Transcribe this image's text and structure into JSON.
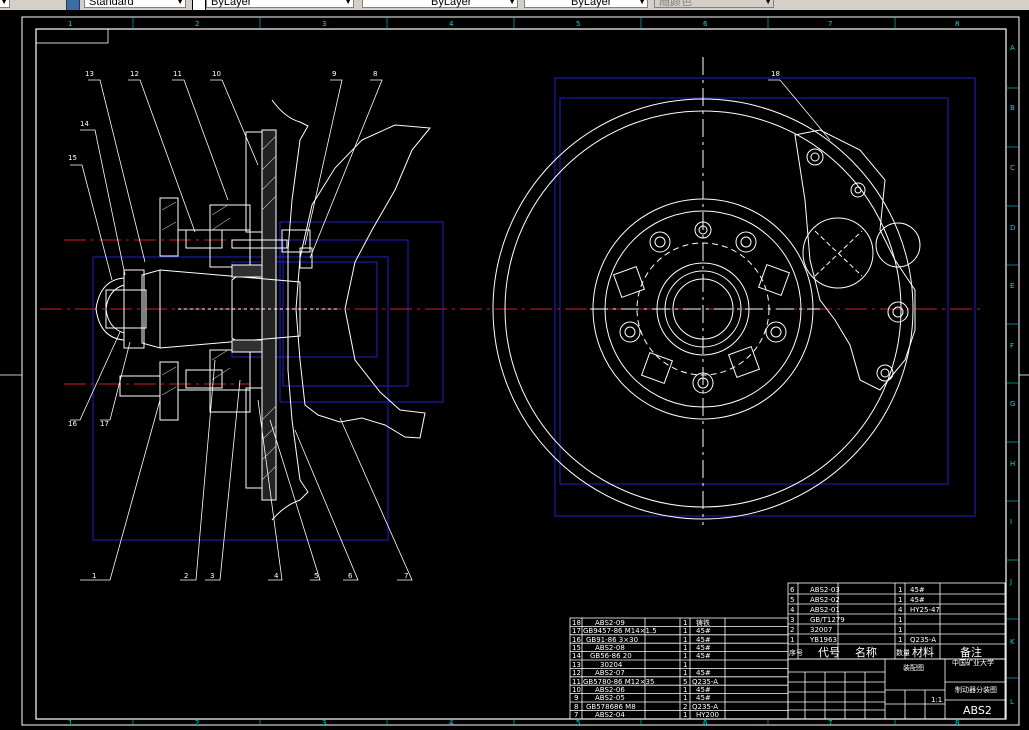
{
  "toolbar": {
    "text_style": "Standard",
    "layer": "ByLayer",
    "linetype": "ByLayer",
    "lineweight": "ByLayer",
    "plot_style": "随颜色"
  },
  "border": {
    "top_numbers": [
      "1",
      "2",
      "3",
      "4",
      "5",
      "6",
      "7",
      "8"
    ],
    "side_letters": [
      "A",
      "B",
      "C",
      "D",
      "E",
      "F",
      "G",
      "H",
      "I",
      "J",
      "K",
      "L"
    ]
  },
  "part_numbers": [
    "1",
    "2",
    "3",
    "4",
    "5",
    "6",
    "7",
    "8",
    "9",
    "10",
    "11",
    "12",
    "13",
    "14",
    "15",
    "16",
    "17",
    "18"
  ],
  "parts_upper": [
    {
      "no": "6",
      "code": "ABS2-03",
      "qty": "1",
      "mat": "45#"
    },
    {
      "no": "5",
      "code": "ABS2-02",
      "qty": "1",
      "mat": "45#"
    },
    {
      "no": "4",
      "code": "ABS2-01",
      "qty": "4",
      "mat": "HY25-47"
    },
    {
      "no": "3",
      "code": "GB/T1279",
      "qty": "1",
      "mat": ""
    },
    {
      "no": "2",
      "code": "32007",
      "qty": "1",
      "mat": ""
    },
    {
      "no": "1",
      "code": "YB1963",
      "qty": "1",
      "mat": "Q235-A"
    }
  ],
  "parts_upper_header": {
    "no": "序号",
    "code": "代号",
    "name": "名称",
    "qty": "数量",
    "mat": "材料",
    "note": "备注"
  },
  "parts_lower": [
    {
      "no": "18",
      "code": "ABS2-09",
      "qty": "1",
      "mat": "铸铁"
    },
    {
      "no": "17",
      "code": "GB9457-86 M14×1.5",
      "qty": "1",
      "mat": "45#"
    },
    {
      "no": "16",
      "code": "GB91-86 3×30",
      "qty": "1",
      "mat": "45#"
    },
    {
      "no": "15",
      "code": "ABS2-08",
      "qty": "1",
      "mat": "45#"
    },
    {
      "no": "14",
      "code": "GB56-86 20",
      "qty": "1",
      "mat": "45#"
    },
    {
      "no": "13",
      "code": "30204",
      "qty": "1",
      "mat": ""
    },
    {
      "no": "12",
      "code": "ABS2-07",
      "qty": "1",
      "mat": "45#"
    },
    {
      "no": "11",
      "code": "GB5780-86 M12×35",
      "qty": "5",
      "mat": "Q235-A"
    },
    {
      "no": "10",
      "code": "ABS2-06",
      "qty": "1",
      "mat": "45#"
    },
    {
      "no": "9",
      "code": "ABS2-05",
      "qty": "1",
      "mat": "45#"
    },
    {
      "no": "8",
      "code": "GB578686 M8",
      "qty": "2",
      "mat": "Q235-A"
    },
    {
      "no": "7",
      "code": "ABS2-04",
      "qty": "1",
      "mat": "HY200"
    }
  ],
  "title_block": {
    "university": "中国矿业大学",
    "drawing_name": "制动器分装图",
    "drawing_no": "ABS2",
    "scale": "1:1",
    "assembly": "装配图"
  }
}
